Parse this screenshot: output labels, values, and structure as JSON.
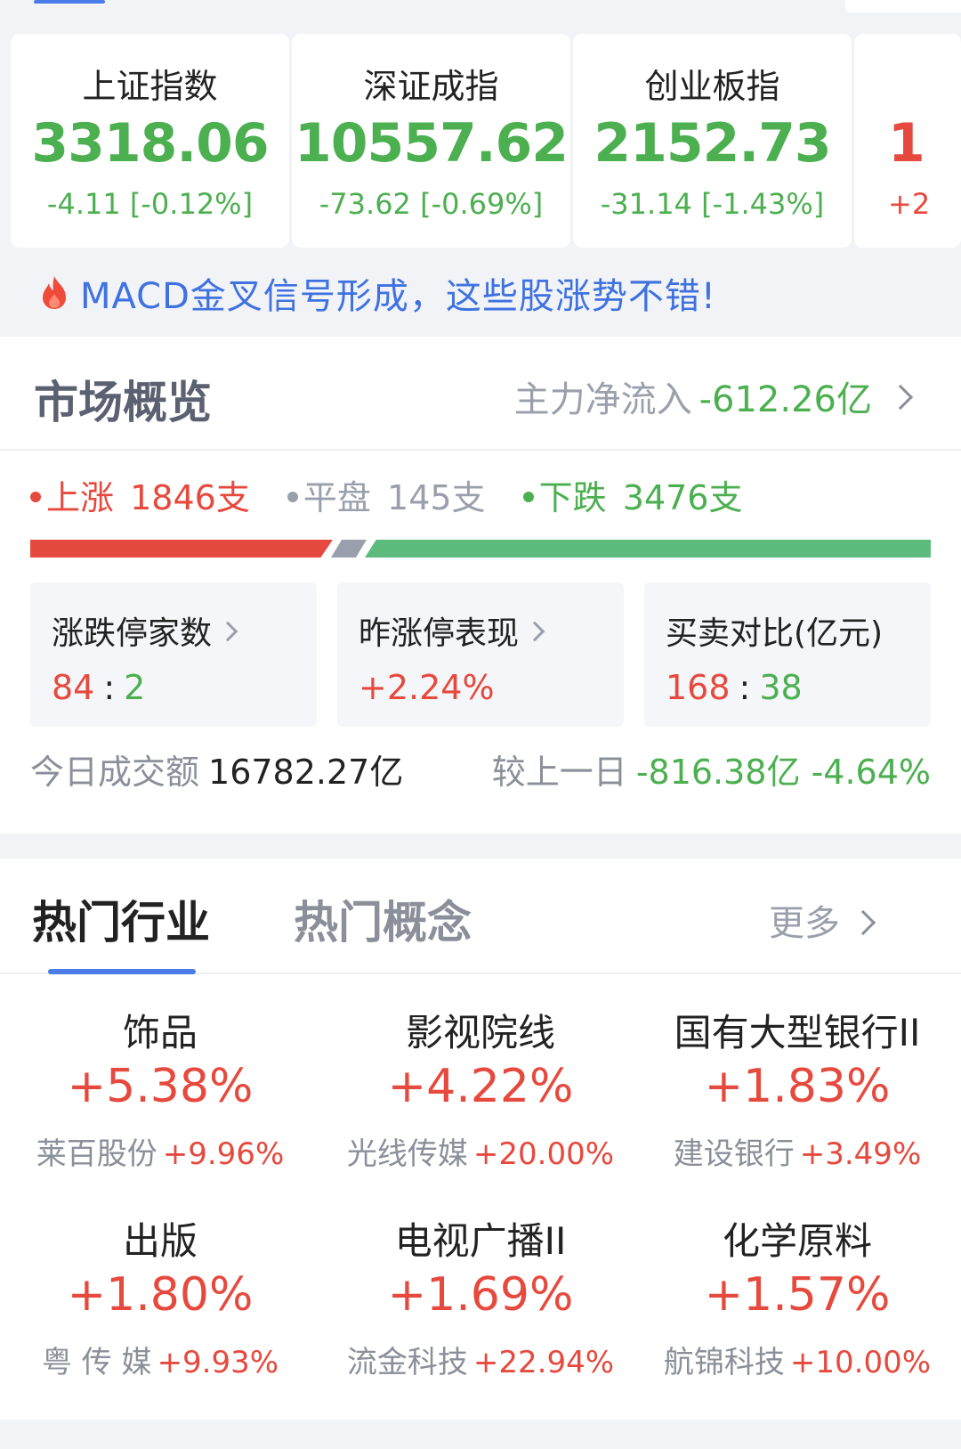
{
  "indices": [
    {
      "name": "上证指数",
      "value": "3318.06",
      "change": "-4.11 [-0.12%]"
    },
    {
      "name": "深证成指",
      "value": "10557.62",
      "change": "-73.62 [-0.69%]"
    },
    {
      "name": "创业板指",
      "value": "2152.73",
      "change": "-31.14 [-1.43%]"
    },
    {
      "name": "",
      "value": "1",
      "change": "+2"
    }
  ],
  "promo": {
    "text": "MACD金叉信号形成，这些股涨势不错!",
    "icon": "fire-icon"
  },
  "overview": {
    "title": "市场概览",
    "flow_label": "主力净流入",
    "flow_value": "-612.26亿",
    "up_label": "上涨",
    "up_count": "1846支",
    "flat_label": "平盘",
    "flat_count": "145支",
    "down_label": "下跌",
    "down_count": "3476支",
    "limit_label": "涨跌停家数",
    "limit_up": "84",
    "limit_down": "2",
    "yesterday_label": "昨涨停表现",
    "yesterday_value": "+2.24%",
    "buysell_label": "买卖对比(亿元)",
    "buy": "168",
    "sell": "38",
    "turnover_label": "今日成交额",
    "turnover_value": "16782.27亿",
    "compare_label": "较上一日",
    "compare_value": "-816.38亿 -4.64%"
  },
  "hot": {
    "tab_industry": "热门行业",
    "tab_concept": "热门概念",
    "more": "更多",
    "sectors": [
      {
        "name": "饰品",
        "pct": "+5.38%",
        "leader": "莱百股份",
        "leader_pct": "+9.96%"
      },
      {
        "name": "影视院线",
        "pct": "+4.22%",
        "leader": "光线传媒",
        "leader_pct": "+20.00%"
      },
      {
        "name": "国有大型银行II",
        "pct": "+1.83%",
        "leader": "建设银行",
        "leader_pct": "+3.49%"
      },
      {
        "name": "出版",
        "pct": "+1.80%",
        "leader": "粤 传 媒",
        "leader_pct": "+9.93%"
      },
      {
        "name": "电视广播II",
        "pct": "+1.69%",
        "leader": "流金科技",
        "leader_pct": "+22.94%"
      },
      {
        "name": "化学原料",
        "pct": "+1.57%",
        "leader": "航锦科技",
        "leader_pct": "+10.00%"
      }
    ]
  },
  "colors": {
    "up": "#e6493d",
    "down": "#4caf50",
    "accent": "#4a7de8",
    "link": "#3f72e0"
  }
}
